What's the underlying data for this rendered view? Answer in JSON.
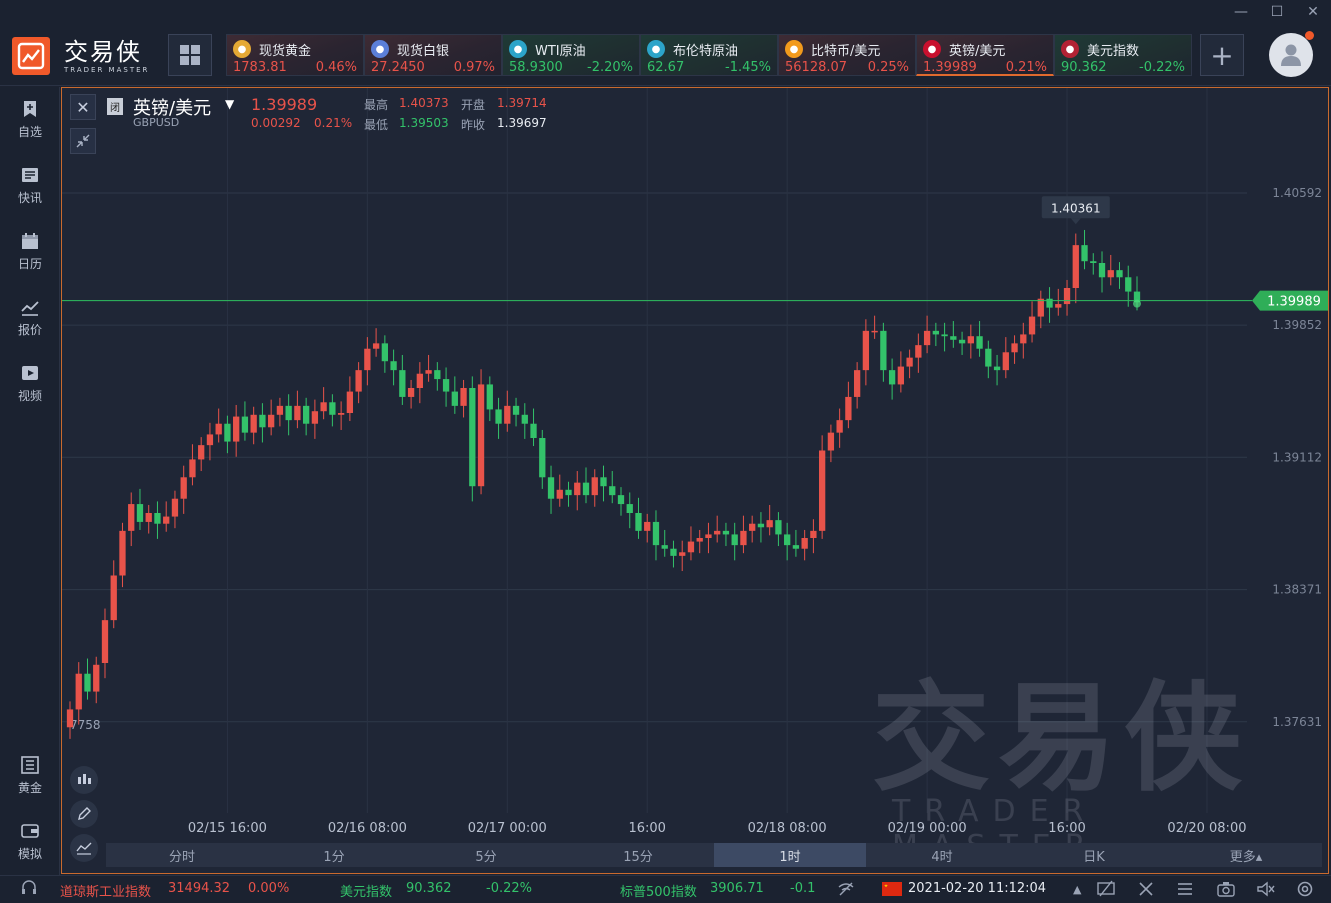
{
  "window": {
    "minimize": "—",
    "maximize": "☐",
    "close": "✕"
  },
  "logo": {
    "cn": "交易侠",
    "en": "TRADER MASTER"
  },
  "tickers": [
    {
      "name": "现货黄金",
      "price": "1783.81",
      "change": "0.46%",
      "dir": "up",
      "icon": "gold-icon",
      "color": "#e5a935"
    },
    {
      "name": "现货白银",
      "price": "27.2450",
      "change": "0.97%",
      "dir": "up",
      "icon": "silver-icon",
      "color": "#5b7fd8"
    },
    {
      "name": "WTI原油",
      "price": "58.9300",
      "change": "-2.20%",
      "dir": "down",
      "icon": "oil-icon",
      "color": "#2ca4c9"
    },
    {
      "name": "布伦特原油",
      "price": "62.67",
      "change": "-1.45%",
      "dir": "down",
      "icon": "oil-icon",
      "color": "#2ca4c9"
    },
    {
      "name": "比特币/美元",
      "price": "56128.07",
      "change": "0.25%",
      "dir": "up",
      "icon": "bitcoin-icon",
      "color": "#f29a1c"
    },
    {
      "name": "英镑/美元",
      "price": "1.39989",
      "change": "0.21%",
      "dir": "up",
      "icon": "uk-flag-icon",
      "color": "#c8102e"
    },
    {
      "name": "美元指数",
      "price": "90.362",
      "change": "-0.22%",
      "dir": "down",
      "icon": "us-flag-icon",
      "color": "#b22234"
    }
  ],
  "sidebar": [
    {
      "label": "自选",
      "icon": "bookmark-icon"
    },
    {
      "label": "快讯",
      "icon": "news-icon"
    },
    {
      "label": "日历",
      "icon": "calendar-icon"
    },
    {
      "label": "报价",
      "icon": "quote-chart-icon"
    },
    {
      "label": "视频",
      "icon": "video-icon"
    },
    {
      "label": "黄金",
      "icon": "gold-grid-icon"
    },
    {
      "label": "模拟",
      "icon": "wallet-icon"
    }
  ],
  "symbol": {
    "market_tag": "闭",
    "name": "英镑/美元",
    "code": "GBPUSD",
    "last": "1.39989",
    "change": "0.00292",
    "change_pct": "0.21%",
    "high_label": "最高",
    "high": "1.40373",
    "open_label": "开盘",
    "open": "1.39714",
    "low_label": "最低",
    "low": "1.39503",
    "prev_label": "昨收",
    "prev": "1.39697"
  },
  "chart_data": {
    "type": "candlestick",
    "title": "英镑/美元",
    "y_ticks": [
      "1.40592",
      "1.39852",
      "1.39112",
      "1.38371",
      "1.37631"
    ],
    "y_tick_values": [
      1.40592,
      1.39852,
      1.39112,
      1.38371,
      1.37631
    ],
    "clipped_tick": "7758",
    "ylim": [
      1.3712,
      1.4118
    ],
    "x_ticks": [
      "02/15 16:00",
      "02/16 08:00",
      "02/17 00:00",
      "16:00",
      "02/18 08:00",
      "02/19 00:00",
      "16:00",
      "02/20 08:00"
    ],
    "x_tick_index": [
      18,
      34,
      50,
      66,
      82,
      98,
      114,
      130
    ],
    "last_price_label": "1.39989",
    "last_price": 1.39989,
    "high_marker_label": "1.40361",
    "high_marker": 1.40361,
    "up_color": "#e8534a",
    "down_color": "#33c26a",
    "closes": [
      1.377,
      1.379,
      1.378,
      1.3795,
      1.382,
      1.3845,
      1.387,
      1.3885,
      1.3875,
      1.388,
      1.3874,
      1.3878,
      1.3888,
      1.39,
      1.391,
      1.3918,
      1.3924,
      1.393,
      1.392,
      1.3934,
      1.3925,
      1.3935,
      1.3928,
      1.3935,
      1.394,
      1.3932,
      1.394,
      1.393,
      1.3937,
      1.3942,
      1.3935,
      1.3936,
      1.3948,
      1.396,
      1.3972,
      1.3975,
      1.3965,
      1.396,
      1.3945,
      1.395,
      1.3958,
      1.396,
      1.3955,
      1.3948,
      1.394,
      1.395,
      1.3895,
      1.3952,
      1.3938,
      1.393,
      1.394,
      1.3935,
      1.393,
      1.3922,
      1.39,
      1.3888,
      1.3893,
      1.389,
      1.3897,
      1.389,
      1.39,
      1.3895,
      1.389,
      1.3885,
      1.388,
      1.387,
      1.3875,
      1.3862,
      1.386,
      1.3856,
      1.3858,
      1.3864,
      1.3866,
      1.3868,
      1.387,
      1.3868,
      1.3862,
      1.387,
      1.3874,
      1.3872,
      1.3876,
      1.3868,
      1.3862,
      1.386,
      1.3866,
      1.387,
      1.3915,
      1.3925,
      1.3932,
      1.3945,
      1.396,
      1.3982,
      1.3982,
      1.396,
      1.3952,
      1.3962,
      1.3967,
      1.3974,
      1.3982,
      1.398,
      1.3979,
      1.3977,
      1.3975,
      1.3979,
      1.3972,
      1.3962,
      1.396,
      1.397,
      1.3975,
      1.398,
      1.399,
      1.4,
      1.3995,
      1.3997,
      1.4006,
      1.403,
      1.4021,
      1.402,
      1.4012,
      1.4016,
      1.4012,
      1.4004,
      1.3998
    ],
    "opens": [
      1.376,
      1.377,
      1.379,
      1.378,
      1.3796,
      1.382,
      1.3845,
      1.387,
      1.3885,
      1.3875,
      1.388,
      1.3874,
      1.3878,
      1.3888,
      1.39,
      1.391,
      1.3918,
      1.3924,
      1.393,
      1.392,
      1.3934,
      1.3925,
      1.3935,
      1.3928,
      1.3935,
      1.394,
      1.3932,
      1.394,
      1.393,
      1.3937,
      1.3942,
      1.3935,
      1.3936,
      1.3948,
      1.396,
      1.3972,
      1.3975,
      1.3965,
      1.396,
      1.3945,
      1.395,
      1.3958,
      1.396,
      1.3955,
      1.3948,
      1.394,
      1.395,
      1.3895,
      1.3952,
      1.3938,
      1.393,
      1.394,
      1.3935,
      1.393,
      1.3922,
      1.39,
      1.3888,
      1.3893,
      1.389,
      1.3897,
      1.389,
      1.39,
      1.3895,
      1.389,
      1.3885,
      1.388,
      1.387,
      1.3875,
      1.3862,
      1.386,
      1.3856,
      1.3858,
      1.3864,
      1.3866,
      1.3868,
      1.387,
      1.3868,
      1.3862,
      1.387,
      1.3874,
      1.3872,
      1.3876,
      1.3868,
      1.3862,
      1.386,
      1.3866,
      1.387,
      1.3915,
      1.3925,
      1.3932,
      1.3945,
      1.396,
      1.3982,
      1.3982,
      1.396,
      1.3952,
      1.3962,
      1.3967,
      1.3974,
      1.3982,
      1.398,
      1.3979,
      1.3977,
      1.3975,
      1.3979,
      1.3972,
      1.3962,
      1.396,
      1.397,
      1.3975,
      1.398,
      1.399,
      1.4,
      1.3995,
      1.3997,
      1.4006,
      1.403,
      1.4021,
      1.402,
      1.4012,
      1.4016,
      1.4012,
      1.4004
    ]
  },
  "timeframes": [
    "分时",
    "1分",
    "5分",
    "15分",
    "1时",
    "4时",
    "日K",
    "更多▴"
  ],
  "timeframe_active": "1时",
  "watermark": {
    "cn": "交易侠",
    "en": "TRADER MASTER"
  },
  "status": {
    "dji_name": "道琼斯工业指数",
    "dji_price": "31494.32",
    "dji_change": "0.00%",
    "dxy_name": "美元指数",
    "dxy_price": "90.362",
    "dxy_change": "-0.22%",
    "spx_name": "标普500指数",
    "spx_price": "3906.71",
    "spx_change": "-0.1",
    "datetime": "2021-02-20 11:12:04"
  }
}
